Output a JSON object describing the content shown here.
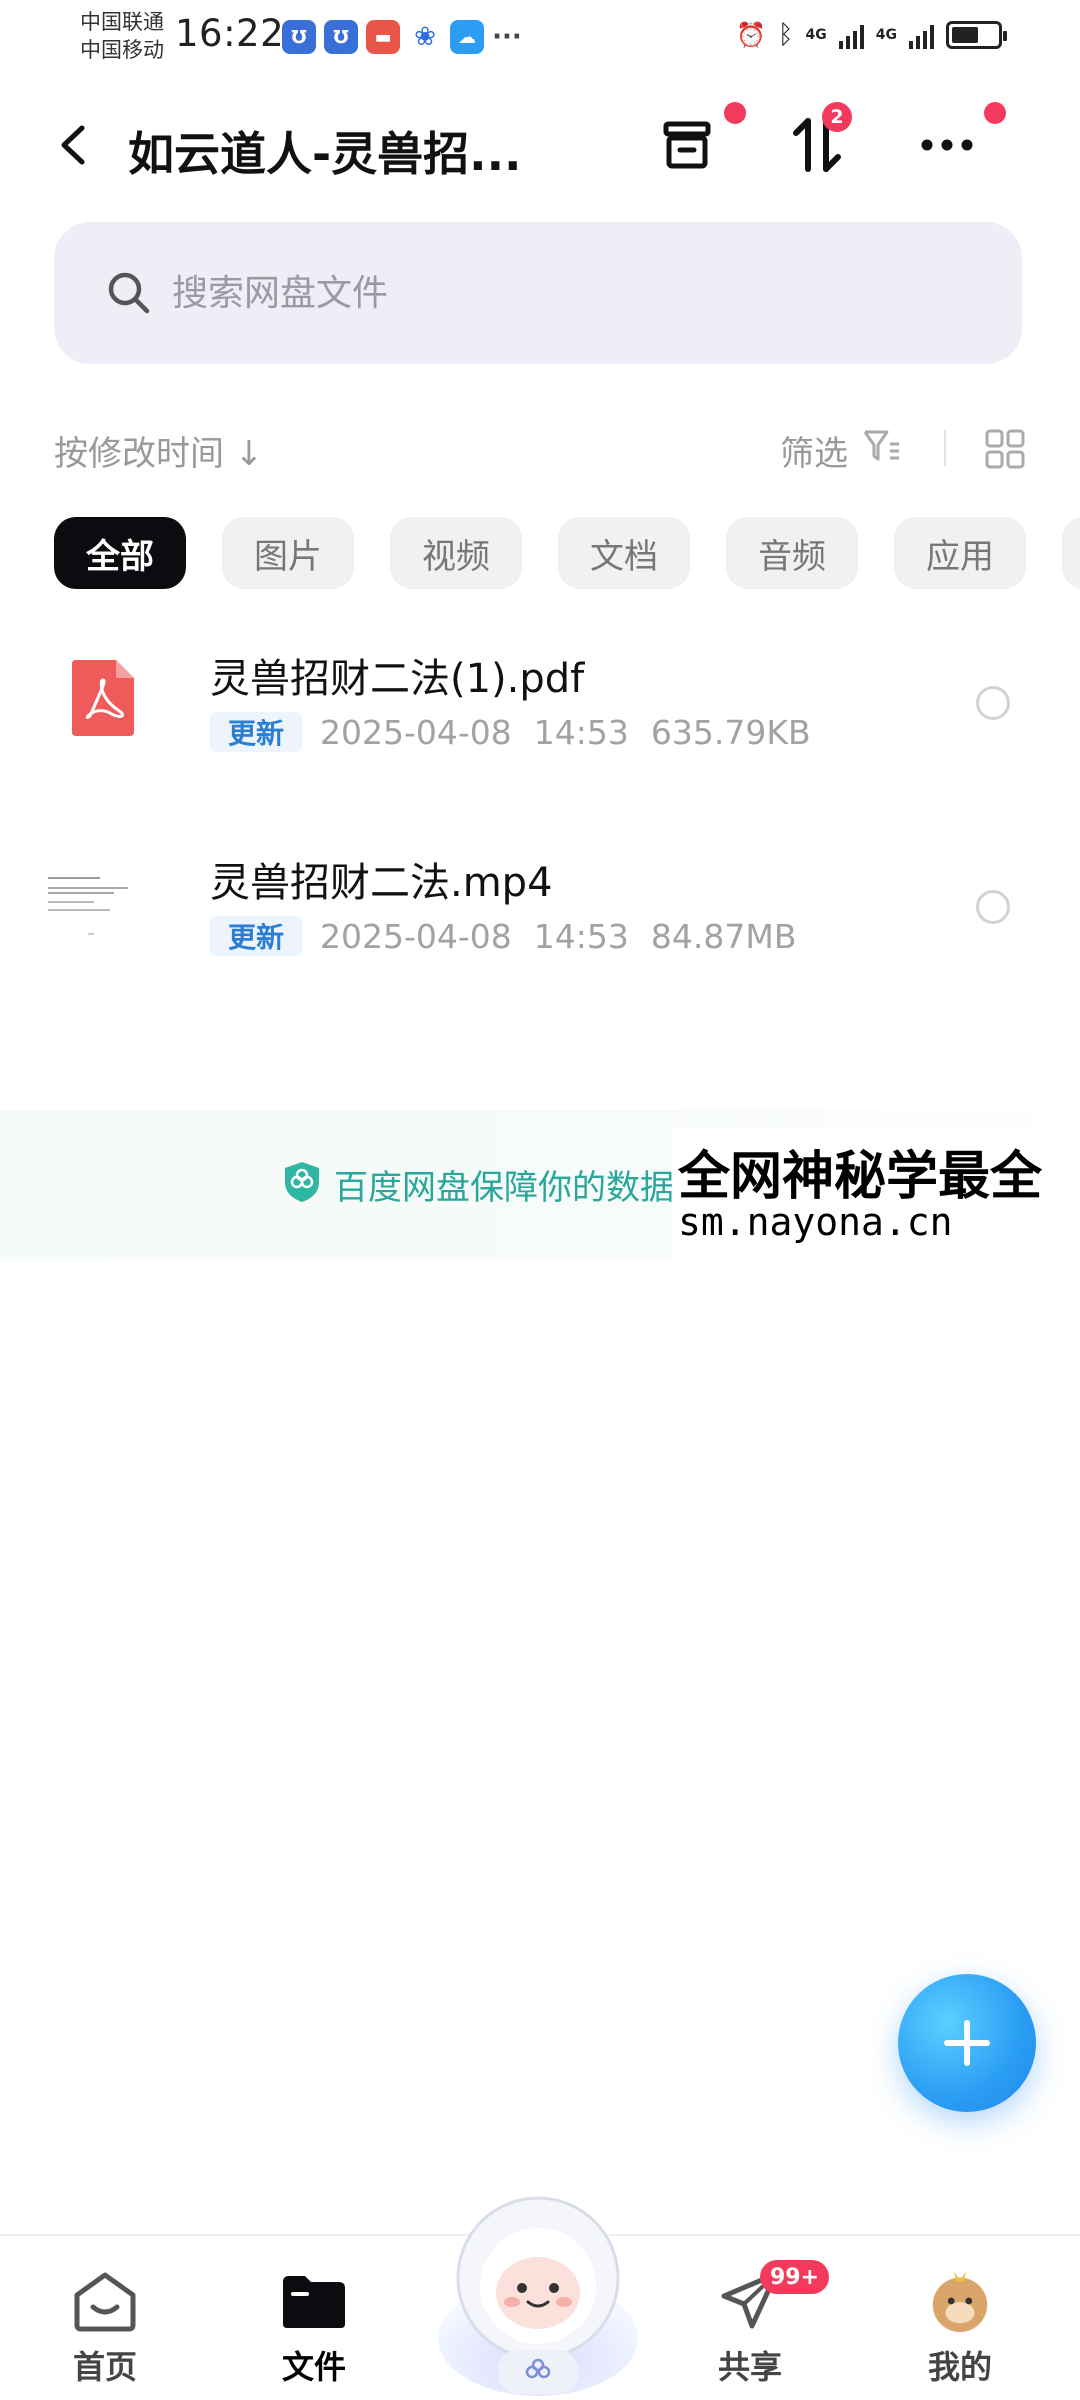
{
  "status_bar": {
    "carrier_1": "中国联通",
    "carrier_2": "中国移动",
    "time": "16:22",
    "network_1": "4G",
    "network_2": "4G"
  },
  "header": {
    "title": "如云道人-灵兽招...",
    "transfer_badge": "2"
  },
  "search": {
    "placeholder": "搜索网盘文件"
  },
  "toolbar": {
    "sort_label": "按修改时间 ↓",
    "filter_label": "筛选"
  },
  "chips": [
    {
      "label": "全部",
      "active": true
    },
    {
      "label": "图片",
      "active": false
    },
    {
      "label": "视频",
      "active": false
    },
    {
      "label": "文档",
      "active": false
    },
    {
      "label": "音频",
      "active": false
    },
    {
      "label": "应用",
      "active": false
    }
  ],
  "files": [
    {
      "name": "灵兽招财二法(1).pdf",
      "tag": "更新",
      "date": "2025-04-08",
      "time": "14:53",
      "size": "635.79KB",
      "type": "pdf-icon"
    },
    {
      "name": "灵兽招财二法.mp4",
      "tag": "更新",
      "date": "2025-04-08",
      "time": "14:53",
      "size": "84.87MB",
      "type": "video-thumbnail"
    }
  ],
  "banner": {
    "text": "百度网盘保障你的数据"
  },
  "watermark": {
    "line1": "全网神秘学最全",
    "line2": "sm.nayona.cn"
  },
  "bottom_nav": {
    "home": "首页",
    "files": "文件",
    "share": "共享",
    "share_badge": "99+",
    "mine": "我的"
  },
  "colors": {
    "accent": "#2a9df4",
    "badge": "#f43a5c",
    "banner_text": "#28a79a",
    "tag_text": "#2a7fd4"
  }
}
